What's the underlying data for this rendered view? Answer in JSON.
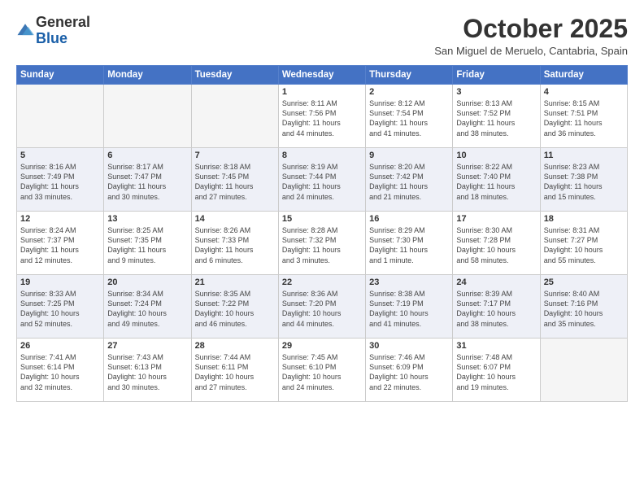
{
  "header": {
    "logo_general": "General",
    "logo_blue": "Blue",
    "month_title": "October 2025",
    "location": "San Miguel de Meruelo, Cantabria, Spain"
  },
  "weekdays": [
    "Sunday",
    "Monday",
    "Tuesday",
    "Wednesday",
    "Thursday",
    "Friday",
    "Saturday"
  ],
  "weeks": [
    [
      {
        "day": "",
        "info": ""
      },
      {
        "day": "",
        "info": ""
      },
      {
        "day": "",
        "info": ""
      },
      {
        "day": "1",
        "info": "Sunrise: 8:11 AM\nSunset: 7:56 PM\nDaylight: 11 hours\nand 44 minutes."
      },
      {
        "day": "2",
        "info": "Sunrise: 8:12 AM\nSunset: 7:54 PM\nDaylight: 11 hours\nand 41 minutes."
      },
      {
        "day": "3",
        "info": "Sunrise: 8:13 AM\nSunset: 7:52 PM\nDaylight: 11 hours\nand 38 minutes."
      },
      {
        "day": "4",
        "info": "Sunrise: 8:15 AM\nSunset: 7:51 PM\nDaylight: 11 hours\nand 36 minutes."
      }
    ],
    [
      {
        "day": "5",
        "info": "Sunrise: 8:16 AM\nSunset: 7:49 PM\nDaylight: 11 hours\nand 33 minutes."
      },
      {
        "day": "6",
        "info": "Sunrise: 8:17 AM\nSunset: 7:47 PM\nDaylight: 11 hours\nand 30 minutes."
      },
      {
        "day": "7",
        "info": "Sunrise: 8:18 AM\nSunset: 7:45 PM\nDaylight: 11 hours\nand 27 minutes."
      },
      {
        "day": "8",
        "info": "Sunrise: 8:19 AM\nSunset: 7:44 PM\nDaylight: 11 hours\nand 24 minutes."
      },
      {
        "day": "9",
        "info": "Sunrise: 8:20 AM\nSunset: 7:42 PM\nDaylight: 11 hours\nand 21 minutes."
      },
      {
        "day": "10",
        "info": "Sunrise: 8:22 AM\nSunset: 7:40 PM\nDaylight: 11 hours\nand 18 minutes."
      },
      {
        "day": "11",
        "info": "Sunrise: 8:23 AM\nSunset: 7:38 PM\nDaylight: 11 hours\nand 15 minutes."
      }
    ],
    [
      {
        "day": "12",
        "info": "Sunrise: 8:24 AM\nSunset: 7:37 PM\nDaylight: 11 hours\nand 12 minutes."
      },
      {
        "day": "13",
        "info": "Sunrise: 8:25 AM\nSunset: 7:35 PM\nDaylight: 11 hours\nand 9 minutes."
      },
      {
        "day": "14",
        "info": "Sunrise: 8:26 AM\nSunset: 7:33 PM\nDaylight: 11 hours\nand 6 minutes."
      },
      {
        "day": "15",
        "info": "Sunrise: 8:28 AM\nSunset: 7:32 PM\nDaylight: 11 hours\nand 3 minutes."
      },
      {
        "day": "16",
        "info": "Sunrise: 8:29 AM\nSunset: 7:30 PM\nDaylight: 11 hours\nand 1 minute."
      },
      {
        "day": "17",
        "info": "Sunrise: 8:30 AM\nSunset: 7:28 PM\nDaylight: 10 hours\nand 58 minutes."
      },
      {
        "day": "18",
        "info": "Sunrise: 8:31 AM\nSunset: 7:27 PM\nDaylight: 10 hours\nand 55 minutes."
      }
    ],
    [
      {
        "day": "19",
        "info": "Sunrise: 8:33 AM\nSunset: 7:25 PM\nDaylight: 10 hours\nand 52 minutes."
      },
      {
        "day": "20",
        "info": "Sunrise: 8:34 AM\nSunset: 7:24 PM\nDaylight: 10 hours\nand 49 minutes."
      },
      {
        "day": "21",
        "info": "Sunrise: 8:35 AM\nSunset: 7:22 PM\nDaylight: 10 hours\nand 46 minutes."
      },
      {
        "day": "22",
        "info": "Sunrise: 8:36 AM\nSunset: 7:20 PM\nDaylight: 10 hours\nand 44 minutes."
      },
      {
        "day": "23",
        "info": "Sunrise: 8:38 AM\nSunset: 7:19 PM\nDaylight: 10 hours\nand 41 minutes."
      },
      {
        "day": "24",
        "info": "Sunrise: 8:39 AM\nSunset: 7:17 PM\nDaylight: 10 hours\nand 38 minutes."
      },
      {
        "day": "25",
        "info": "Sunrise: 8:40 AM\nSunset: 7:16 PM\nDaylight: 10 hours\nand 35 minutes."
      }
    ],
    [
      {
        "day": "26",
        "info": "Sunrise: 7:41 AM\nSunset: 6:14 PM\nDaylight: 10 hours\nand 32 minutes."
      },
      {
        "day": "27",
        "info": "Sunrise: 7:43 AM\nSunset: 6:13 PM\nDaylight: 10 hours\nand 30 minutes."
      },
      {
        "day": "28",
        "info": "Sunrise: 7:44 AM\nSunset: 6:11 PM\nDaylight: 10 hours\nand 27 minutes."
      },
      {
        "day": "29",
        "info": "Sunrise: 7:45 AM\nSunset: 6:10 PM\nDaylight: 10 hours\nand 24 minutes."
      },
      {
        "day": "30",
        "info": "Sunrise: 7:46 AM\nSunset: 6:09 PM\nDaylight: 10 hours\nand 22 minutes."
      },
      {
        "day": "31",
        "info": "Sunrise: 7:48 AM\nSunset: 6:07 PM\nDaylight: 10 hours\nand 19 minutes."
      },
      {
        "day": "",
        "info": ""
      }
    ]
  ]
}
